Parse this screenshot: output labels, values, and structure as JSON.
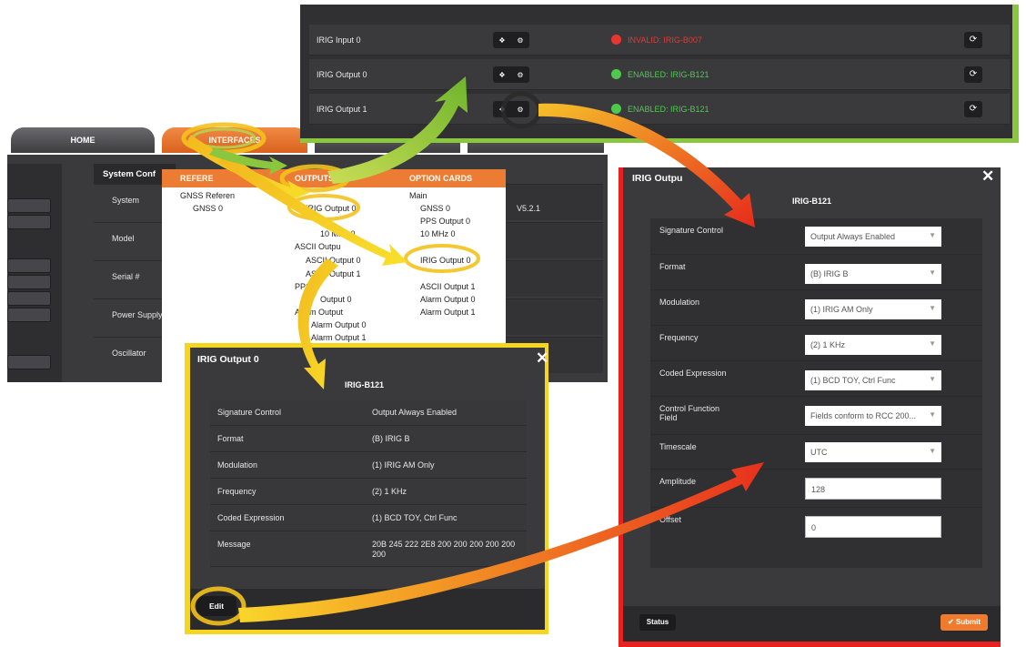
{
  "tabs": {
    "home": "HOME",
    "interfaces": "INTERFACES"
  },
  "system": {
    "title": "System Conf",
    "rows": [
      "System",
      "Model",
      "Serial #",
      "Power Supply",
      "Oscillator"
    ],
    "version": "V5.2.1"
  },
  "menu": {
    "headers": {
      "references": "REFERE",
      "outputs": "OUTPUTS",
      "option_cards": "OPTION CARDS"
    },
    "references": [
      "GNSS Referen",
      "GNSS 0"
    ],
    "outputs": [
      "IRIG Output 0",
      "10 MHz 0",
      "ASCII Outpu",
      "ASCII Output 0",
      "ASCII Output 1",
      "PPS",
      "Output 0",
      "Alarm Output",
      "Alarm Output 0",
      "Alarm Output 1"
    ],
    "option_cards": [
      "Main",
      "GNSS 0",
      "PPS Output 0",
      "10 MHz 0",
      "IRIG Output 0",
      "ASCII Output 1",
      "Alarm Output 0",
      "Alarm Output 1"
    ]
  },
  "status_panel": {
    "rows": [
      {
        "name": "IRIG Input 0",
        "status": "INVALID: IRIG-B007",
        "status_color": "#e8362f"
      },
      {
        "name": "IRIG Output 0",
        "status": "ENABLED: IRIG-B121",
        "status_color": "#4ec94e"
      },
      {
        "name": "IRIG Output 1",
        "status": "ENABLED: IRIG-B121",
        "status_color": "#4ec94e"
      }
    ]
  },
  "view_modal": {
    "title": "IRIG Output 0",
    "subtitle": "IRIG-B121",
    "close": "✕",
    "rows": [
      {
        "label": "Signature Control",
        "value": "Output Always Enabled"
      },
      {
        "label": "Format",
        "value": "(B) IRIG B"
      },
      {
        "label": "Modulation",
        "value": "(1) IRIG AM Only"
      },
      {
        "label": "Frequency",
        "value": "(2) 1 KHz"
      },
      {
        "label": "Coded Expression",
        "value": "(1) BCD TOY, Ctrl Func"
      },
      {
        "label": "Message",
        "value": "20B 245 222 2E8 200 200 200 200 200 200"
      }
    ],
    "edit_label": "Edit"
  },
  "edit_modal": {
    "title": "IRIG Outpu",
    "subtitle": "IRIG-B121",
    "close": "✕",
    "fields": {
      "signature_control": {
        "label": "Signature Control",
        "value": "Output Always Enabled"
      },
      "format": {
        "label": "Format",
        "value": "(B) IRIG B"
      },
      "modulation": {
        "label": "Modulation",
        "value": "(1) IRIG AM Only"
      },
      "frequency": {
        "label": "Frequency",
        "value": "(2) 1 KHz"
      },
      "coded_expression": {
        "label": "Coded Expression",
        "value": "(1) BCD TOY, Ctrl Func"
      },
      "control_function_field": {
        "label": "Control Function Field",
        "value": "Fields conform to RCC 200..."
      },
      "timescale": {
        "label": "Timescale",
        "value": "UTC"
      },
      "amplitude": {
        "label": "Amplitude",
        "value": "128"
      },
      "offset": {
        "label": "Offset",
        "value": "0"
      }
    },
    "status_label": "Status",
    "submit_label": "✔ Submit"
  },
  "colors": {
    "accent_orange": "#ec7b33",
    "green_frame": "#8bc63f",
    "yellow_frame": "#f5d51d",
    "red_frame": "#e8211f"
  },
  "icons": [
    "info-icon",
    "gear-icon",
    "refresh-icon",
    "close-icon",
    "caret-down-icon",
    "check-icon"
  ]
}
